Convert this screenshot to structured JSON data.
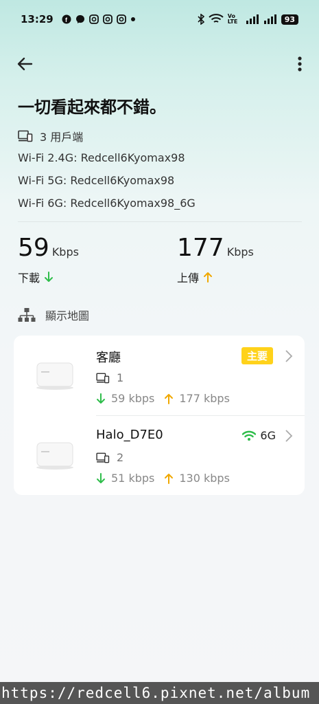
{
  "status": {
    "time": "13:29",
    "battery": "93",
    "lte": "Vo LTE"
  },
  "headline": "一切看起來都不錯。",
  "clients": {
    "count_label": "3 用戶端"
  },
  "wifi": {
    "band_24": "Wi-Fi 2.4G: Redcell6Kyomax98",
    "band_5": "Wi-Fi 5G: Redcell6Kyomax98",
    "band_6": "Wi-Fi 6G: Redcell6Kyomax98_6G"
  },
  "speed": {
    "download_value": "59",
    "download_unit": "Kbps",
    "download_label": "下載",
    "upload_value": "177",
    "upload_unit": "Kbps",
    "upload_label": "上傳"
  },
  "map": {
    "label": "顯示地圖"
  },
  "nodes": [
    {
      "name": "客廳",
      "badge": "主要",
      "clients": "1",
      "down": "59 kbps",
      "up": "177 kbps"
    },
    {
      "name": "Halo_D7E0",
      "band": "6G",
      "clients": "2",
      "down": "51 kbps",
      "up": "130 kbps"
    }
  ],
  "watermark": "https://redcell6.pixnet.net/album",
  "colors": {
    "accent_green": "#2ebd4a",
    "accent_yellow": "#f0a800",
    "badge_yellow": "#ffd21a"
  }
}
